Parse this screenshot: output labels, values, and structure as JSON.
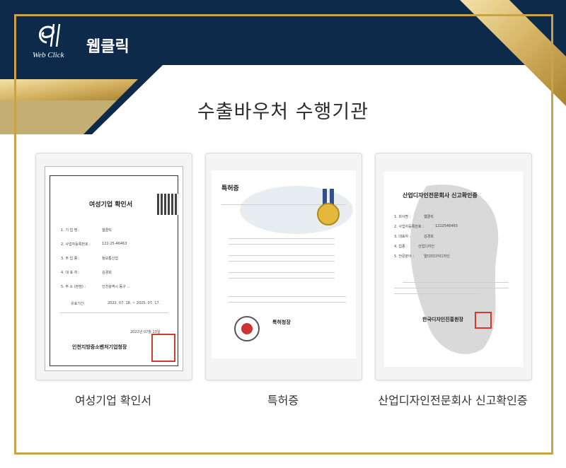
{
  "brand": {
    "logo_sub": "Web Click",
    "name": "웹클릭"
  },
  "title": "수출바우처 수행기관",
  "cards": [
    {
      "caption": "여성기업 확인서",
      "doc_title": "여성기업 확인서",
      "fields": [
        {
          "label": "1. 기   업   명 :",
          "value": "웹클릭"
        },
        {
          "label": "2. 사업자등록번호 :",
          "value": "122-25-46463"
        },
        {
          "label": "3. 주   업   종 :",
          "value": "정보통신업"
        },
        {
          "label": "4. 대   표   자 :",
          "value": "김경희"
        },
        {
          "label": "5. 주   소 (본점) :",
          "value": "인천광역시 동구 ..."
        }
      ],
      "valid_label": "유효기간:",
      "valid_value": "2022. 07. 18.   ~   2025. 07. 17.",
      "date": "2022년 07월 13일",
      "issuer": "인천지방중소벤처기업청장"
    },
    {
      "caption": "특허증",
      "doc_title": "특허증",
      "issuer": "특허청장"
    },
    {
      "caption": "산업디자인전문회사 신고확인증",
      "doc_title": "산업디자인전문회사 신고확인증",
      "fields": [
        {
          "label": "1. 회사명 :",
          "value": "웹클릭"
        },
        {
          "label": "2. 사업자등록번호 :",
          "value": "1222546463"
        },
        {
          "label": "3. 대표자 :",
          "value": "김경희"
        },
        {
          "label": "4. 업종 :",
          "value": "산업디자인"
        },
        {
          "label": "5. 전문분야 :",
          "value": "멀티미디어디자인"
        }
      ],
      "issuer": "한국디자인진흥원장"
    }
  ],
  "colors": {
    "navy": "#0d2a4b",
    "gold": "#c9a24a"
  }
}
